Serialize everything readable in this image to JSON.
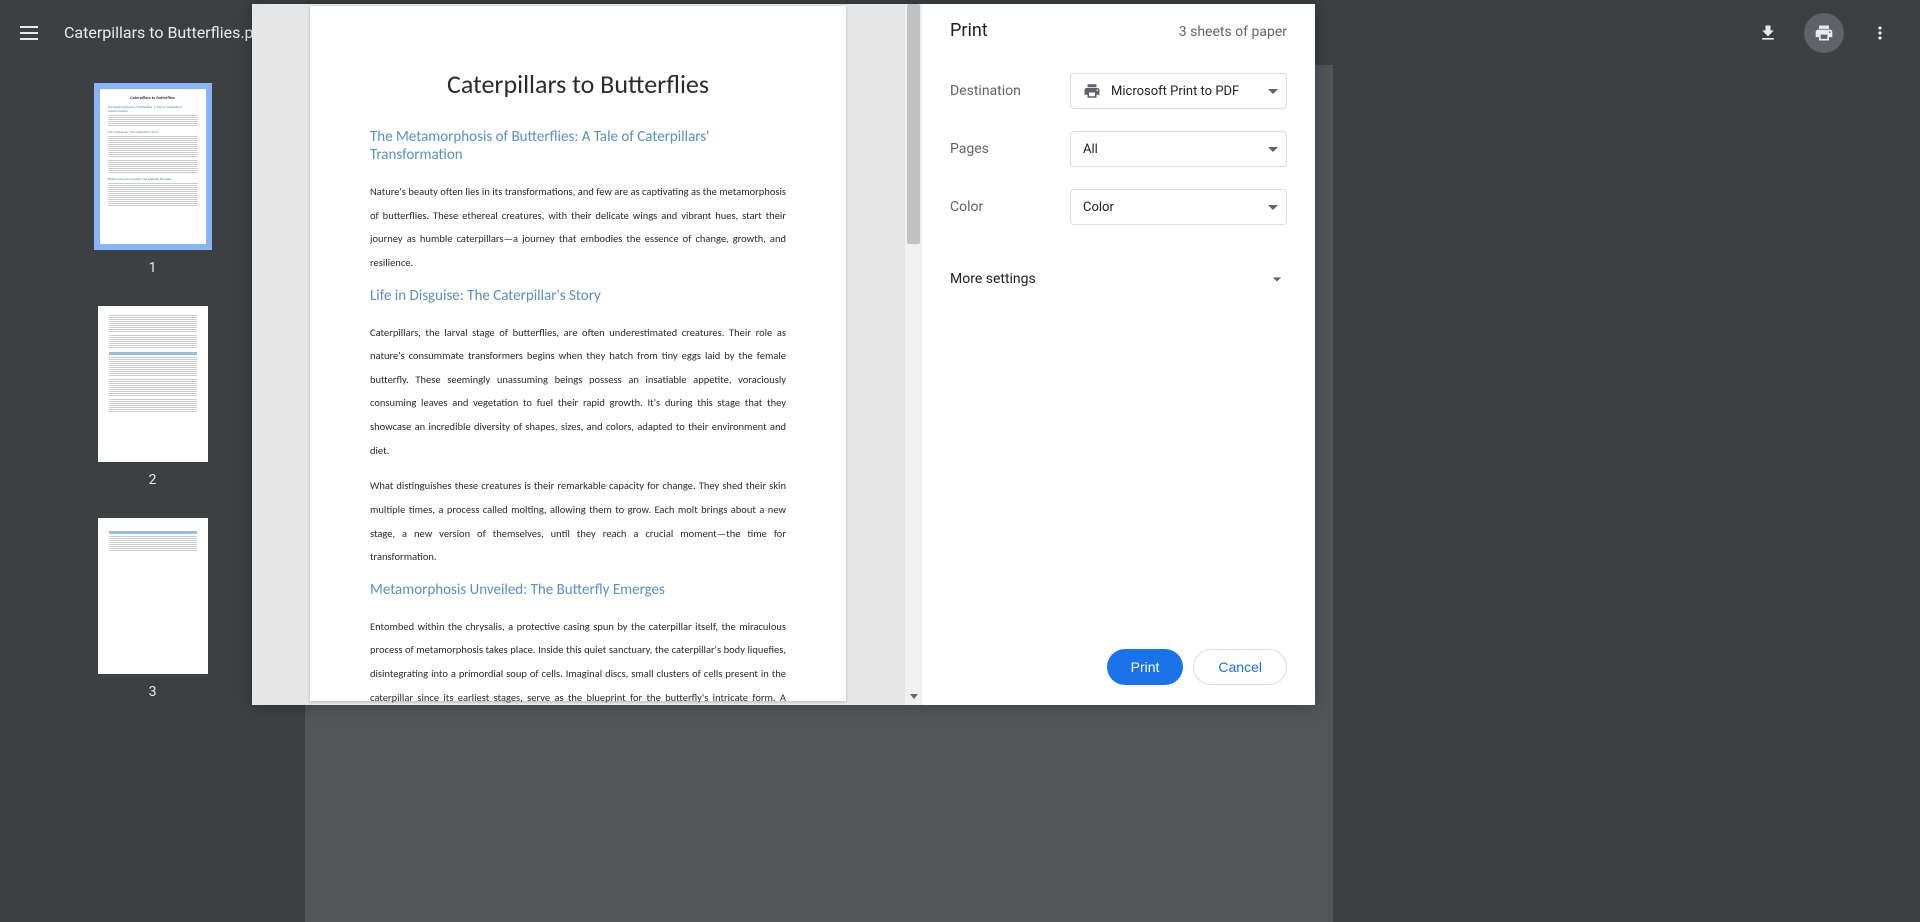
{
  "toolbar": {
    "filename": "Caterpillars to Butterflies.pdf"
  },
  "thumbnails": [
    {
      "num": "1",
      "active": true
    },
    {
      "num": "2",
      "active": false
    },
    {
      "num": "3",
      "active": false
    }
  ],
  "document": {
    "title": "Caterpillars to Butterflies",
    "sections": [
      {
        "heading": "The Metamorphosis of Butterflies: A Tale of Caterpillars' Transformation",
        "paragraphs": [
          "Nature's beauty often lies in its transformations, and few are as captivating as the metamorphosis of butterflies. These ethereal creatures, with their delicate wings and vibrant hues, start their journey as humble caterpillars—a journey that embodies the essence of change, growth, and resilience."
        ]
      },
      {
        "heading": "Life in Disguise: The Caterpillar's Story",
        "paragraphs": [
          "Caterpillars, the larval stage of butterflies, are often underestimated creatures. Their role as nature's consummate transformers begins when they hatch from tiny eggs laid by the female butterfly. These seemingly unassuming beings possess an insatiable appetite, voraciously consuming leaves and vegetation to fuel their rapid growth. It's during this stage that they showcase an incredible diversity of shapes, sizes, and colors, adapted to their environment and diet.",
          "What distinguishes these creatures is their remarkable capacity for change. They shed their skin multiple times, a process called molting, allowing them to grow. Each molt brings about a new stage, a new version of themselves, until they reach a crucial moment—the time for transformation."
        ]
      },
      {
        "heading": "Metamorphosis Unveiled: The Butterfly Emerges",
        "paragraphs": [
          "Entombed within the chrysalis, a protective casing spun by the caterpillar itself, the miraculous process of metamorphosis takes place. Inside this quiet sanctuary, the caterpillar's body liquefies, disintegrating into a primordial soup of cells. Imaginal discs, small clusters of cells present in the caterpillar since its earliest stages, serve as the blueprint for the butterfly's intricate form. A marvel of biological engineering unfolds as these cells divide, multiply, and rearrange, crafting the wings, legs, antennae, and other features of the emerging butterfly."
        ]
      }
    ]
  },
  "print": {
    "title": "Print",
    "sheets": "3 sheets of paper",
    "destination_label": "Destination",
    "destination_value": "Microsoft Print to PDF",
    "pages_label": "Pages",
    "pages_value": "All",
    "color_label": "Color",
    "color_value": "Color",
    "more_settings": "More settings",
    "print_btn": "Print",
    "cancel_btn": "Cancel"
  }
}
